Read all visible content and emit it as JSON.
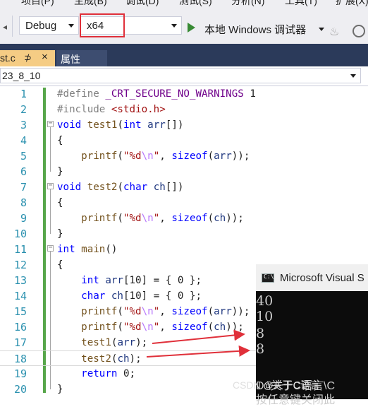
{
  "menu": [
    "项目(P)",
    "生成(B)",
    "调试(D)",
    "测试(S)",
    "分析(N)",
    "工具(T)",
    "扩展(X)"
  ],
  "toolbar": {
    "config": "Debug",
    "platform": "x64",
    "run_label": "本地 Windows 调试器",
    "icons": [
      "run-icon",
      "flame-icon"
    ]
  },
  "tabs": [
    {
      "label": "st.c",
      "pin": "⊅",
      "close": "×"
    },
    {
      "label": "属性"
    }
  ],
  "nav": {
    "scope": "23_8_10"
  },
  "editor": {
    "line_numbers": [
      "1",
      "2",
      "3",
      "4",
      "5",
      "6",
      "7",
      "8",
      "9",
      "10",
      "11",
      "12",
      "13",
      "14",
      "15",
      "16",
      "17",
      "18",
      "19",
      "20"
    ]
  },
  "console": {
    "title": "Microsoft Visual S",
    "output": [
      "40",
      "10",
      "8",
      "8"
    ],
    "footer_lines": [
      "D:\\关于C语言\\C",
      "按任意键关闭此"
    ]
  },
  "watermark": "CSDN @关于C语言"
}
